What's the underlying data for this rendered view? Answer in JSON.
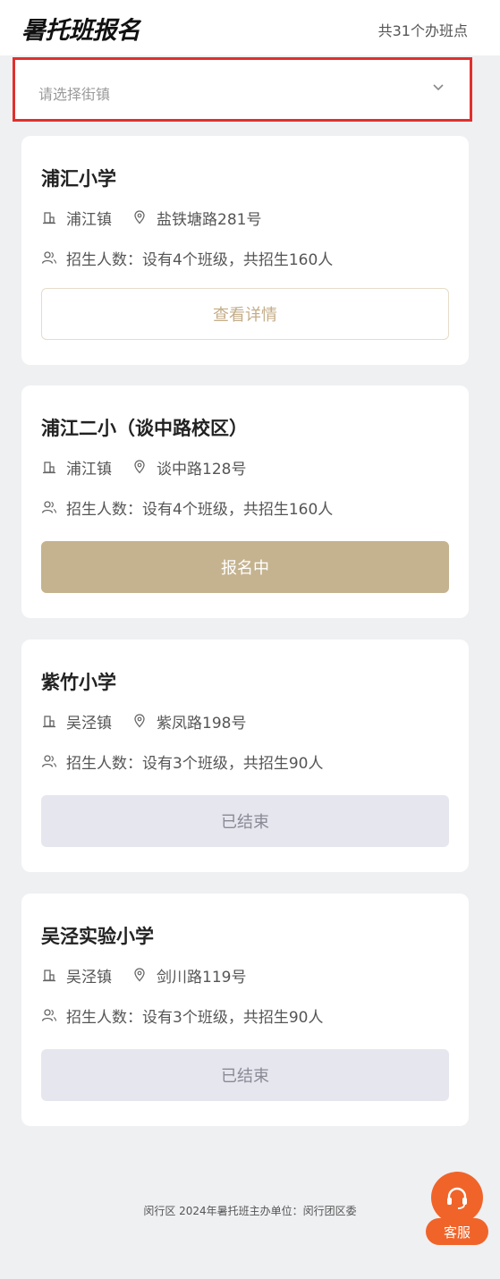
{
  "header": {
    "title": "暑托班报名",
    "site_count": "共31个办班点"
  },
  "filter": {
    "placeholder": "请选择街镇"
  },
  "cards": [
    {
      "name": "浦汇小学",
      "town": "浦江镇",
      "address": "盐铁塘路281号",
      "enrollment": "招生人数：设有4个班级，共招生160人",
      "button": "查看详情"
    },
    {
      "name": "浦江二小（谈中路校区）",
      "town": "浦江镇",
      "address": "谈中路128号",
      "enrollment": "招生人数：设有4个班级，共招生160人",
      "button": "报名中"
    },
    {
      "name": "紫竹小学",
      "town": "吴泾镇",
      "address": "紫凤路198号",
      "enrollment": "招生人数：设有3个班级，共招生90人",
      "button": "已结束"
    },
    {
      "name": "吴泾实验小学",
      "town": "吴泾镇",
      "address": "剑川路119号",
      "enrollment": "招生人数：设有3个班级，共招生90人",
      "button": "已结束"
    }
  ],
  "footer": {
    "text": "闵行区 2024年暑托班主办单位：闵行团区委"
  },
  "customer_service": {
    "label": "客服",
    "icon": "headset-icon"
  },
  "colors": {
    "accent_gold": "#c5b38f",
    "highlight_red": "#e0302e",
    "service_orange": "#f0642a",
    "ended_gray": "#e6e6ee"
  }
}
